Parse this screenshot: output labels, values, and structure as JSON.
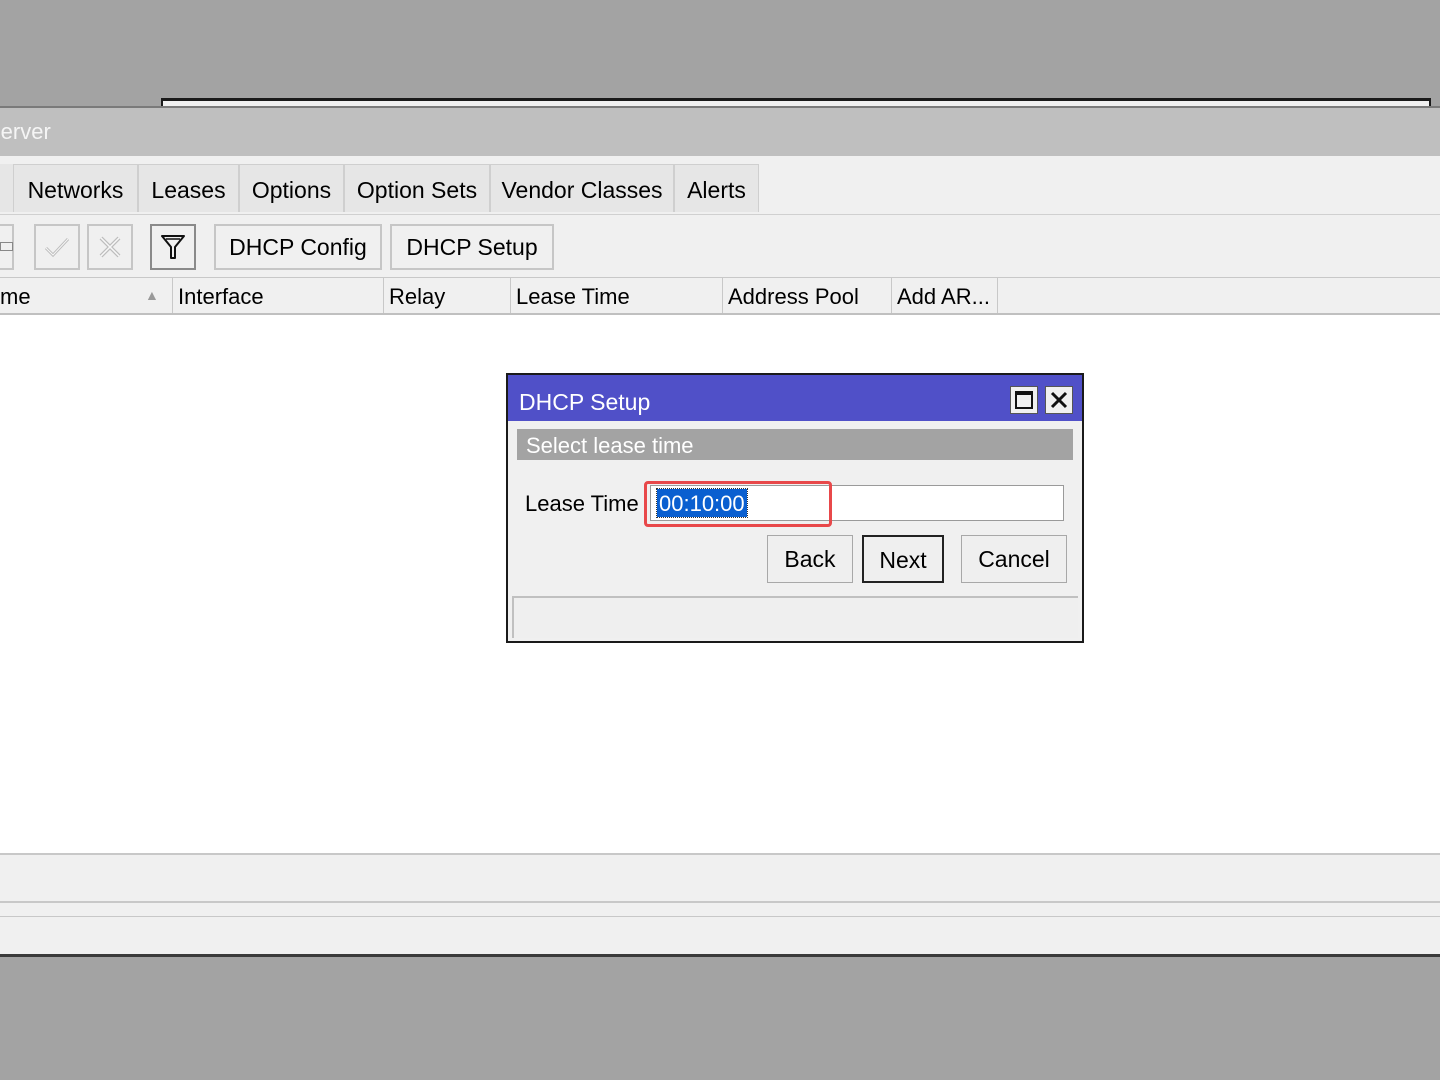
{
  "window": {
    "title": "Server"
  },
  "tabs": [
    "Networks",
    "Leases",
    "Options",
    "Option Sets",
    "Vendor Classes",
    "Alerts"
  ],
  "toolbar": {
    "dhcp_config_label": "DHCP Config",
    "dhcp_setup_label": "DHCP Setup"
  },
  "columns": [
    "me",
    "Interface",
    "Relay",
    "Lease Time",
    "Address Pool",
    "Add AR..."
  ],
  "dialog": {
    "title": "DHCP Setup",
    "step": "Select lease time",
    "lease_label": "Lease Time",
    "lease_value": "00:10:00",
    "back_label": "Back",
    "next_label": "Next",
    "cancel_label": "Cancel"
  },
  "colors": {
    "dialog_title_bg": "#5050c8",
    "highlight": "#e8484a",
    "selection": "#0a5fd0"
  },
  "icons": [
    "enable-icon",
    "disable-icon",
    "filter-icon",
    "maximize-icon",
    "close-icon"
  ]
}
